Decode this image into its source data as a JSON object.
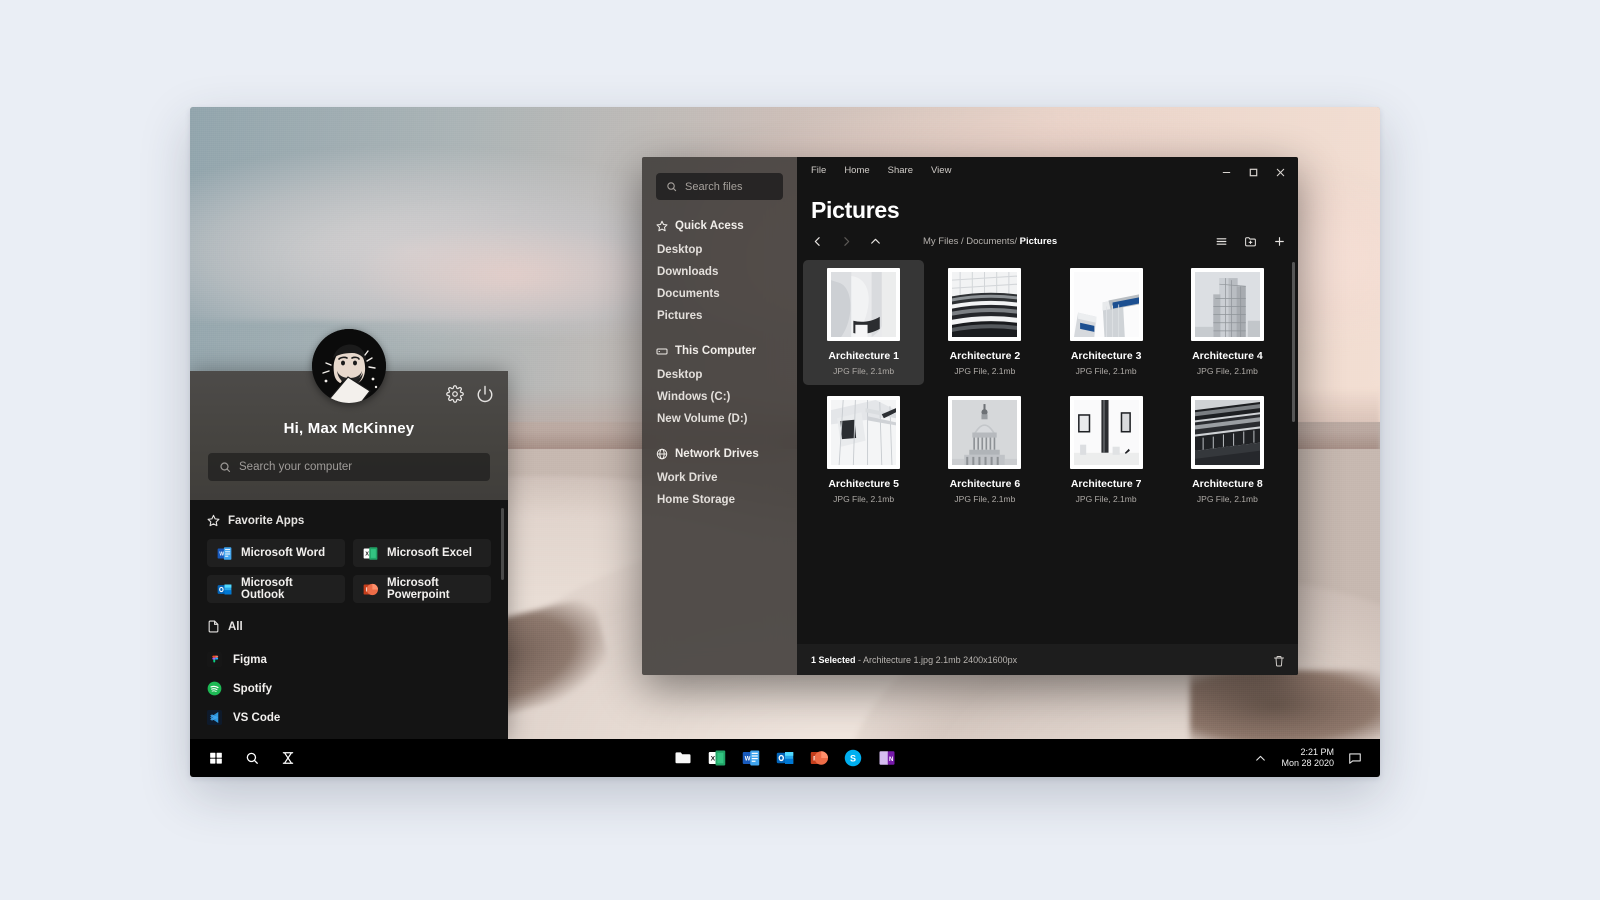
{
  "start_menu": {
    "greeting": "Hi, Max McKinney",
    "search_placeholder": "Search your computer",
    "settings_icon": "gear-icon",
    "power_icon": "power-icon",
    "favorites_label": "Favorite Apps",
    "favorites": [
      {
        "label": "Microsoft Word",
        "icon": "word-icon"
      },
      {
        "label": "Microsoft Excel",
        "icon": "excel-icon"
      },
      {
        "label": "Microsoft Outlook",
        "icon": "outlook-icon"
      },
      {
        "label": "Microsoft Powerpoint",
        "icon": "powerpoint-icon"
      }
    ],
    "all_label": "All",
    "all_apps": [
      {
        "label": "Figma",
        "icon": "figma-icon"
      },
      {
        "label": "Spotify",
        "icon": "spotify-icon"
      },
      {
        "label": "VS Code",
        "icon": "vscode-icon"
      }
    ]
  },
  "explorer": {
    "search_placeholder": "Search files",
    "sidebar": {
      "groups": [
        {
          "title": "Quick Acess",
          "icon": "star-icon",
          "items": [
            "Desktop",
            "Downloads",
            "Documents",
            "Pictures"
          ]
        },
        {
          "title": "This Computer",
          "icon": "drive-icon",
          "items": [
            "Desktop",
            "Windows (C:)",
            "New Volume (D:)"
          ]
        },
        {
          "title": "Network Drives",
          "icon": "globe-icon",
          "items": [
            "Work Drive",
            "Home Storage"
          ]
        }
      ]
    },
    "menu": [
      "File",
      "Home",
      "Share",
      "View"
    ],
    "window_buttons": [
      "minimize-icon",
      "maximize-icon",
      "close-icon"
    ],
    "title": "Pictures",
    "breadcrumb_prefix": "My Files / Documents/ ",
    "breadcrumb_current": "Pictures",
    "nav_icons": [
      "back-icon",
      "forward-icon",
      "up-icon"
    ],
    "action_icons": [
      "list-view-icon",
      "new-folder-icon",
      "add-icon"
    ],
    "files": [
      {
        "name": "Architecture 1",
        "meta": "JPG File, 2.1mb",
        "selected": true
      },
      {
        "name": "Architecture 2",
        "meta": "JPG File, 2.1mb",
        "selected": false
      },
      {
        "name": "Architecture 3",
        "meta": "JPG File, 2.1mb",
        "selected": false
      },
      {
        "name": "Architecture 4",
        "meta": "JPG File, 2.1mb",
        "selected": false
      },
      {
        "name": "Architecture 5",
        "meta": "JPG File, 2.1mb",
        "selected": false
      },
      {
        "name": "Architecture 6",
        "meta": "JPG File, 2.1mb",
        "selected": false
      },
      {
        "name": "Architecture 7",
        "meta": "JPG File, 2.1mb",
        "selected": false
      },
      {
        "name": "Architecture 8",
        "meta": "JPG File, 2.1mb",
        "selected": false
      }
    ],
    "status": {
      "count": "1 Selected",
      "detail": " - Architecture 1.jpg  2.1mb  2400x1600px",
      "trash_icon": "trash-icon"
    }
  },
  "taskbar": {
    "left_icons": [
      "windows-start-icon",
      "search-icon",
      "task-view-icon"
    ],
    "apps": [
      "file-explorer-icon",
      "excel-icon",
      "word-icon",
      "outlook-icon",
      "powerpoint-icon",
      "skype-icon",
      "onenote-icon"
    ],
    "chevron_icon": "chevron-up-icon",
    "time": "2:21 PM",
    "date": "Mon 28 2020",
    "notification_icon": "notification-icon"
  },
  "colors": {
    "page_background": "#eaeef5",
    "window_dark": "#141414",
    "sidebar": "#3a3734",
    "start_menu_top": "#45433f",
    "selected_tile": "#363636",
    "status_bar": "#1d1d1d"
  }
}
